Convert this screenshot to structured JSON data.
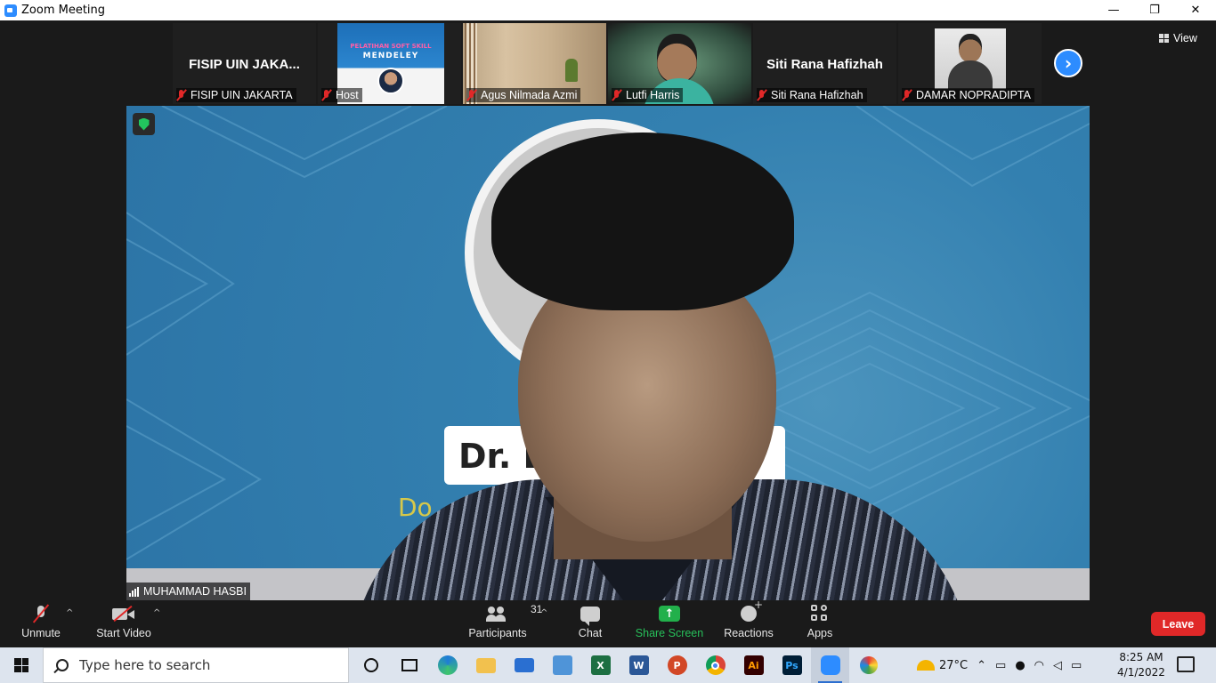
{
  "window": {
    "title": "Zoom Meeting",
    "controls": {
      "minimize": "—",
      "restore": "❐",
      "close": "✕"
    }
  },
  "participants_strip": [
    {
      "big_name": "FISIP UIN JAKA...",
      "label": "FISIP UIN JAKARTA",
      "muted": true
    },
    {
      "big_name": "",
      "label": "Host",
      "muted": true,
      "poster_title": "PELATIHAN SOFT SKILL",
      "poster_subject": "MENDELEY"
    },
    {
      "big_name": "",
      "label": "Agus Nilmada Azmi",
      "muted": true
    },
    {
      "big_name": "",
      "label": "Lutfi Harris",
      "muted": true
    },
    {
      "big_name": "Siti Rana Hafizhah",
      "label": "Siti Rana Hafizhah",
      "muted": true
    },
    {
      "big_name": "",
      "label": "DAMAR NOPRADIPTA",
      "muted": true
    }
  ],
  "view_button": {
    "label": "View",
    "icon": "grid-icon"
  },
  "next_page_icon": "chevron-right-icon",
  "main_video": {
    "speaker": "MUHAMMAD HASBI",
    "card_text": "Dr. L",
    "card_subtitle": "Do",
    "encryption_icon": "shield-check-icon"
  },
  "controls": {
    "unmute": "Unmute",
    "start_video": "Start Video",
    "participants": "Participants",
    "participants_count": "31",
    "chat": "Chat",
    "share_screen": "Share Screen",
    "reactions": "Reactions",
    "apps": "Apps",
    "leave": "Leave",
    "caret": "^"
  },
  "taskbar": {
    "search_placeholder": "Type here to search",
    "weather": "27°C",
    "time": "8:25 AM",
    "date": "4/1/2022",
    "app_icons": [
      "cortana-icon",
      "task-view-icon",
      "edge-icon",
      "file-explorer-icon",
      "mail-icon",
      "photos-icon",
      "excel-icon",
      "word-icon",
      "powerpoint-icon",
      "chrome-icon",
      "illustrator-icon",
      "photoshop-icon",
      "zoom-icon",
      "paint-icon"
    ],
    "app_letters": {
      "excel": "X",
      "word": "W",
      "powerpoint": "P",
      "illustrator": "Ai",
      "photoshop": "Ps"
    }
  },
  "colors": {
    "accent_blue": "#2d8cff",
    "leave_red": "#e02828",
    "share_green": "#22b04b",
    "video_blue": "#2c74a6"
  }
}
